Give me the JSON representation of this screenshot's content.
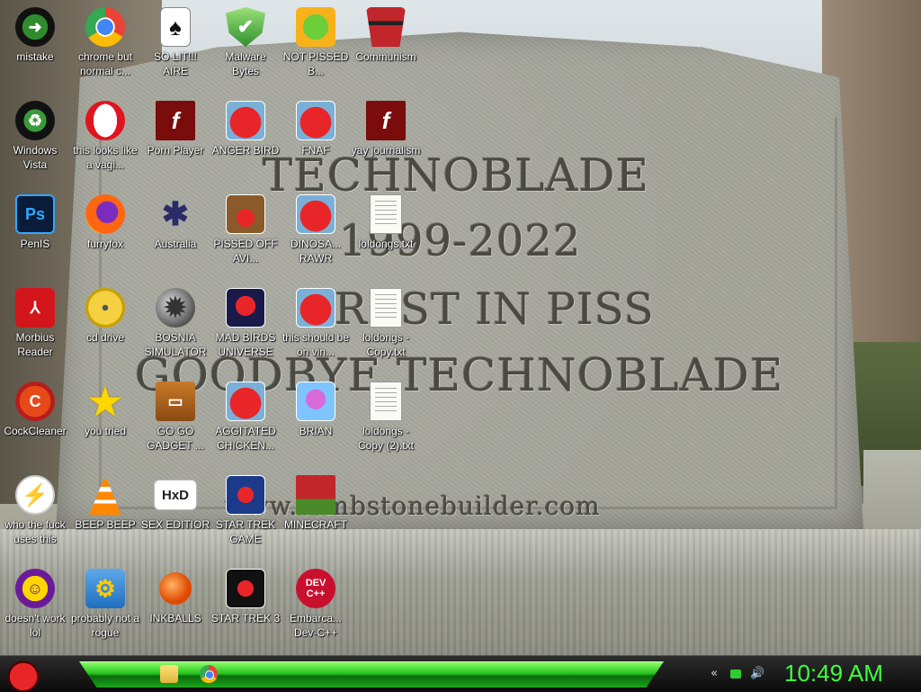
{
  "wallpaper": {
    "line1": "TECHNOBLADE",
    "line2": "1999-2022",
    "line3": "REST IN PISS",
    "line4": "GOODBYE TECHNOBLADE",
    "watermark": "www.tombstonebuilder.com"
  },
  "desktop_icons": [
    {
      "id": "mistake",
      "label": "mistake",
      "icon": "green-circle-arrow-icon"
    },
    {
      "id": "chrome",
      "label": "chrome but normal c...",
      "icon": "chrome-icon"
    },
    {
      "id": "solitaire",
      "label": "SO LIT!!! AIRE",
      "icon": "playing-cards-icon"
    },
    {
      "id": "malwarebytes",
      "label": "Malware Bytes",
      "icon": "green-shield-icon"
    },
    {
      "id": "notpissed",
      "label": "NOT PISSED B...",
      "icon": "green-pig-icon"
    },
    {
      "id": "communism",
      "label": "Communism",
      "icon": "red-emblem-icon"
    },
    {
      "id": "windowsvista",
      "label": "Windows Vista",
      "icon": "recycle-icon"
    },
    {
      "id": "opera",
      "label": "this looks like a vagi...",
      "icon": "opera-icon"
    },
    {
      "id": "pornplayer",
      "label": "Porn Player",
      "icon": "flash-icon"
    },
    {
      "id": "angerbird",
      "label": "ANGER BIRD",
      "icon": "angry-bird-icon"
    },
    {
      "id": "fnaf",
      "label": "FNAF",
      "icon": "angry-bird-icon"
    },
    {
      "id": "yay",
      "label": "yay journalism",
      "icon": "flash-icon"
    },
    {
      "id": "penis",
      "label": "PenIS",
      "icon": "photoshop-icon"
    },
    {
      "id": "furryfox",
      "label": "furryfox",
      "icon": "firefox-icon"
    },
    {
      "id": "australia",
      "label": "Australia",
      "icon": "spider-solitaire-icon"
    },
    {
      "id": "pissedoff",
      "label": "PISSED OFF AVI...",
      "icon": "angry-birds-seasons-icon"
    },
    {
      "id": "dinosaur",
      "label": "DINOSA... RAWR",
      "icon": "angry-bird-icon"
    },
    {
      "id": "loldongs1",
      "label": "loldongs.txt",
      "icon": "text-file-icon"
    },
    {
      "id": "morbius",
      "label": "Morbius Reader",
      "icon": "pdf-reader-icon"
    },
    {
      "id": "cddrive",
      "label": "cd drive",
      "icon": "cd-icon"
    },
    {
      "id": "bosnia",
      "label": "BOSNIA SIMULATOR",
      "icon": "mine-icon"
    },
    {
      "id": "madbirds",
      "label": "MAD BIRDS UNIVERSE",
      "icon": "angry-birds-space-icon"
    },
    {
      "id": "vine",
      "label": "this should be on vin...",
      "icon": "angry-bird-icon"
    },
    {
      "id": "loldongs2",
      "label": "loldongs - Copy.txt",
      "icon": "text-file-icon"
    },
    {
      "id": "cockcleaner",
      "label": "CockCleaner",
      "icon": "ccleaner-icon"
    },
    {
      "id": "youtried",
      "label": "you tried",
      "icon": "star-icon"
    },
    {
      "id": "gogadget",
      "label": "GO GO GADGET ...",
      "icon": "briefcase-icon"
    },
    {
      "id": "aggitated",
      "label": "AGGITATED CHICKEN...",
      "icon": "angry-bird-icon"
    },
    {
      "id": "brian",
      "label": "BRIAN",
      "icon": "angry-birds-rio-icon"
    },
    {
      "id": "loldongs3",
      "label": "loldongs - Copy (2).txt",
      "icon": "text-file-icon"
    },
    {
      "id": "whothefuck",
      "label": "who the fuck uses this",
      "icon": "lightning-icon"
    },
    {
      "id": "beepbeep",
      "label": "BEEP BEEP",
      "icon": "vlc-icon"
    },
    {
      "id": "sexeditor",
      "label": "SEX EDITIOR",
      "icon": "hxd-icon"
    },
    {
      "id": "startrekgame",
      "label": "STAR TREK GAME",
      "icon": "angry-birds-star-wars-icon"
    },
    {
      "id": "minecraft",
      "label": "MINECRAFT",
      "icon": "minecraft-icon"
    },
    {
      "id": "yahoo",
      "label": "doesn't work lol",
      "icon": "yahoo-messenger-icon"
    },
    {
      "id": "rogue",
      "label": "probably not a rogue",
      "icon": "gears-icon"
    },
    {
      "id": "inkballs",
      "label": "INKBALLS",
      "icon": "inkball-icon"
    },
    {
      "id": "startrek3",
      "label": "STAR TREK 3",
      "icon": "angry-birds-star-wars-icon"
    },
    {
      "id": "devcpp",
      "label": "Embarca... Dev-C++",
      "icon": "dev-cpp-icon"
    }
  ],
  "taskbar": {
    "start_icon": "angry-bird-icon",
    "pinned": [
      "folder-icon",
      "chrome-icon"
    ],
    "tray": [
      "back-arrow-icon",
      "network-icon",
      "speaker-icon"
    ],
    "clock": "10:49 AM"
  }
}
